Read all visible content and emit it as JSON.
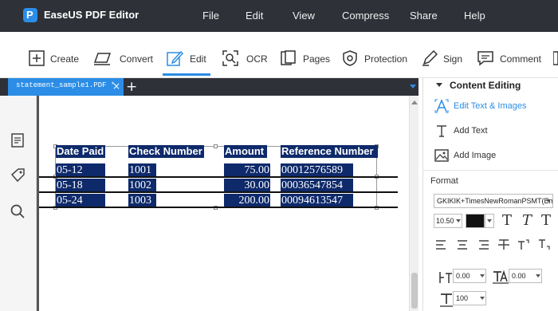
{
  "app": {
    "title": "EaseUS PDF Editor",
    "logo_glyph": "P",
    "menu": [
      "File",
      "Edit",
      "View",
      "Compress",
      "Share",
      "Help"
    ]
  },
  "toolbar": {
    "tools": [
      {
        "label": "Create",
        "icon": "plus-square-icon"
      },
      {
        "label": "Convert",
        "icon": "convert-icon"
      },
      {
        "label": "Edit",
        "icon": "pencil-edit-icon",
        "active": true
      },
      {
        "label": "OCR",
        "icon": "ocr-icon"
      },
      {
        "label": "Pages",
        "icon": "pages-icon"
      },
      {
        "label": "Protection",
        "icon": "shield-icon"
      },
      {
        "label": "Sign",
        "icon": "pen-sign-icon"
      },
      {
        "label": "Comment",
        "icon": "comment-icon"
      }
    ]
  },
  "tabs": {
    "active_tab": "statement_sample1.PDF *",
    "close_glyph": "×",
    "add_glyph": "+"
  },
  "document": {
    "headers": [
      "Date Paid",
      "Check Number",
      "Amount",
      "Reference Number"
    ],
    "rows": [
      [
        "05-12",
        "1001",
        "75.00",
        "00012576589"
      ],
      [
        "05-18",
        "1002",
        "30.00",
        "00036547854"
      ],
      [
        "05-24",
        "1003",
        "200.00",
        "00094613547"
      ]
    ]
  },
  "right_panel": {
    "heading": "Content Editing",
    "items": [
      {
        "label": "Edit Text & Images",
        "icon": "edit-text-image-icon",
        "active": true
      },
      {
        "label": "Add Text",
        "icon": "add-text-icon"
      },
      {
        "label": "Add Image",
        "icon": "add-image-icon"
      }
    ],
    "format_label": "Format",
    "font_name": "GKIKIK+TimesNewRomanPSMT(Embe",
    "font_size": "10.50",
    "text_color": "#111111",
    "char_spacing": "0.00",
    "line_spacing": "0.00",
    "scale": "100",
    "style_glyphs": [
      "T",
      "T",
      "T"
    ],
    "accent_color": "#2b8de6"
  }
}
